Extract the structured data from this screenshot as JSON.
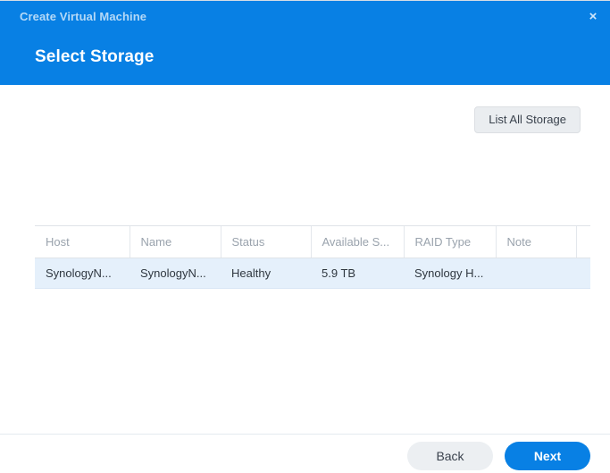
{
  "window": {
    "title": "Create Virtual Machine",
    "close_icon": "×",
    "subtitle": "Select Storage"
  },
  "toolbar": {
    "list_all_storage_label": "List All Storage"
  },
  "table": {
    "columns": [
      {
        "key": "host",
        "label": "Host"
      },
      {
        "key": "name",
        "label": "Name"
      },
      {
        "key": "status",
        "label": "Status"
      },
      {
        "key": "avail",
        "label": "Available S..."
      },
      {
        "key": "raid",
        "label": "RAID Type"
      },
      {
        "key": "note",
        "label": "Note"
      },
      {
        "key": "spacer",
        "label": ""
      }
    ],
    "rows": [
      {
        "host": "SynologyN...",
        "name": "SynologyN...",
        "status": "Healthy",
        "avail": "5.9 TB",
        "raid": "Synology H...",
        "note": "",
        "spacer": "",
        "selected": true
      }
    ]
  },
  "footer": {
    "back_label": "Back",
    "next_label": "Next"
  },
  "colors": {
    "header_blue": "#0880e4",
    "accent_blue": "#0880e4",
    "status_green": "#1faa1f",
    "row_selected": "#e5f0fb",
    "button_gray": "#eceff2"
  }
}
